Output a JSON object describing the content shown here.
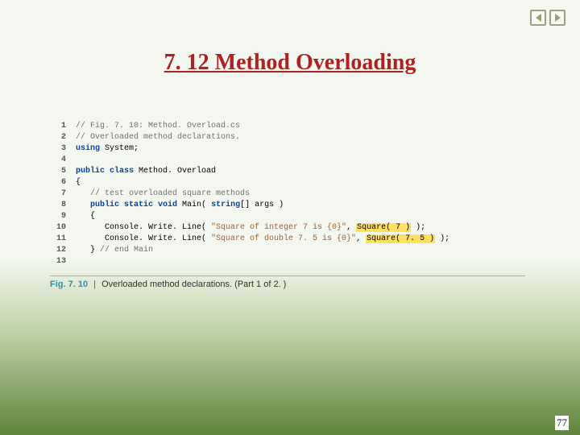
{
  "title": "7. 12 Method Overloading",
  "page_number": "77",
  "nav": {
    "prev": "previous slide",
    "next": "next slide"
  },
  "figure": {
    "label": "Fig. 7. 10",
    "caption": "Overloaded method declarations. (Part 1 of 2. )",
    "lines": [
      {
        "n": "1",
        "segments": [
          {
            "cls": "cmt",
            "t": "// Fig. 7. 10: Method. Overload.cs"
          }
        ]
      },
      {
        "n": "2",
        "segments": [
          {
            "cls": "cmt",
            "t": "// Overloaded method declarations."
          }
        ]
      },
      {
        "n": "3",
        "segments": [
          {
            "cls": "kw",
            "t": "using"
          },
          {
            "cls": "",
            "t": " System;"
          }
        ]
      },
      {
        "n": "4",
        "segments": []
      },
      {
        "n": "5",
        "segments": [
          {
            "cls": "kw",
            "t": "public class"
          },
          {
            "cls": "",
            "t": " Method. Overload"
          }
        ]
      },
      {
        "n": "6",
        "segments": [
          {
            "cls": "",
            "t": "{"
          }
        ]
      },
      {
        "n": "7",
        "segments": [
          {
            "cls": "",
            "t": "   "
          },
          {
            "cls": "cmt",
            "t": "// test overloaded square methods"
          }
        ]
      },
      {
        "n": "8",
        "segments": [
          {
            "cls": "",
            "t": "   "
          },
          {
            "cls": "kw",
            "t": "public static void"
          },
          {
            "cls": "",
            "t": " Main( "
          },
          {
            "cls": "kw",
            "t": "string"
          },
          {
            "cls": "",
            "t": "[] args )"
          }
        ]
      },
      {
        "n": "9",
        "segments": [
          {
            "cls": "",
            "t": "   {"
          }
        ]
      },
      {
        "n": "10",
        "segments": [
          {
            "cls": "",
            "t": "      Console. Write. Line( "
          },
          {
            "cls": "str",
            "t": "\"Square of integer 7 is {0}\""
          },
          {
            "cls": "",
            "t": ", "
          },
          {
            "cls": "hi",
            "t": "Square( 7 )"
          },
          {
            "cls": "",
            "t": " );"
          }
        ]
      },
      {
        "n": "11",
        "segments": [
          {
            "cls": "",
            "t": "      Console. Write. Line( "
          },
          {
            "cls": "str",
            "t": "\"Square of double 7. 5 is {0}\""
          },
          {
            "cls": "",
            "t": ", "
          },
          {
            "cls": "hi",
            "t": "Square( 7. 5 )"
          },
          {
            "cls": "",
            "t": " );"
          }
        ]
      },
      {
        "n": "12",
        "segments": [
          {
            "cls": "",
            "t": "   } "
          },
          {
            "cls": "cmt",
            "t": "// end Main"
          }
        ]
      },
      {
        "n": "13",
        "segments": []
      }
    ]
  }
}
